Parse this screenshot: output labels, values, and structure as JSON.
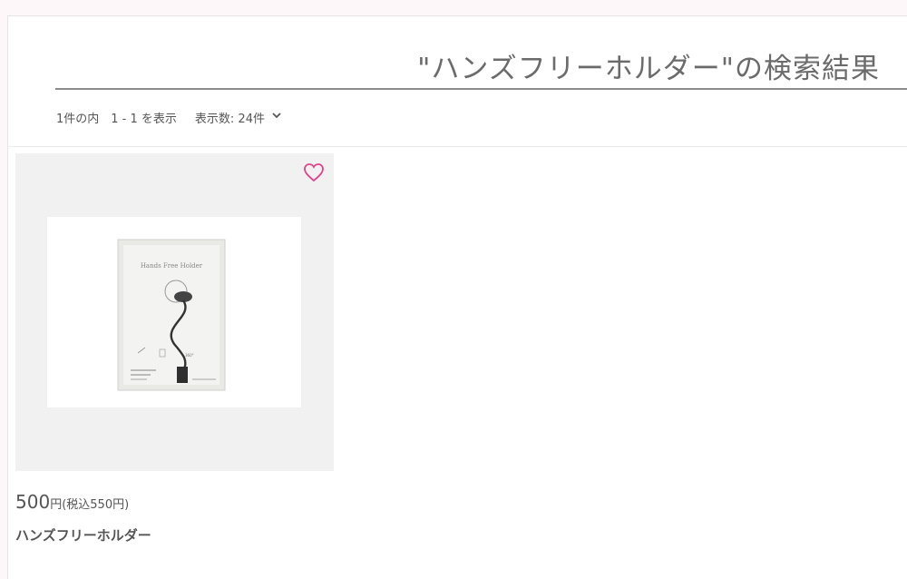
{
  "search": {
    "title": "\"ハンズフリーホルダー\"の検索結果"
  },
  "results": {
    "count_text": "1件の内　1 - 1 を表示",
    "per_page_label": "表示数: 24件"
  },
  "products": [
    {
      "price": "500",
      "price_unit": "円",
      "price_tax": "(税込550円)",
      "name": "ハンズフリーホルダー",
      "package_title": "Hands Free Holder"
    }
  ],
  "colors": {
    "favorite": "#e0438b",
    "title": "#6b6b6b"
  },
  "icons": {
    "favorite": "heart-outline-icon",
    "per_page": "chevron-down-icon"
  }
}
